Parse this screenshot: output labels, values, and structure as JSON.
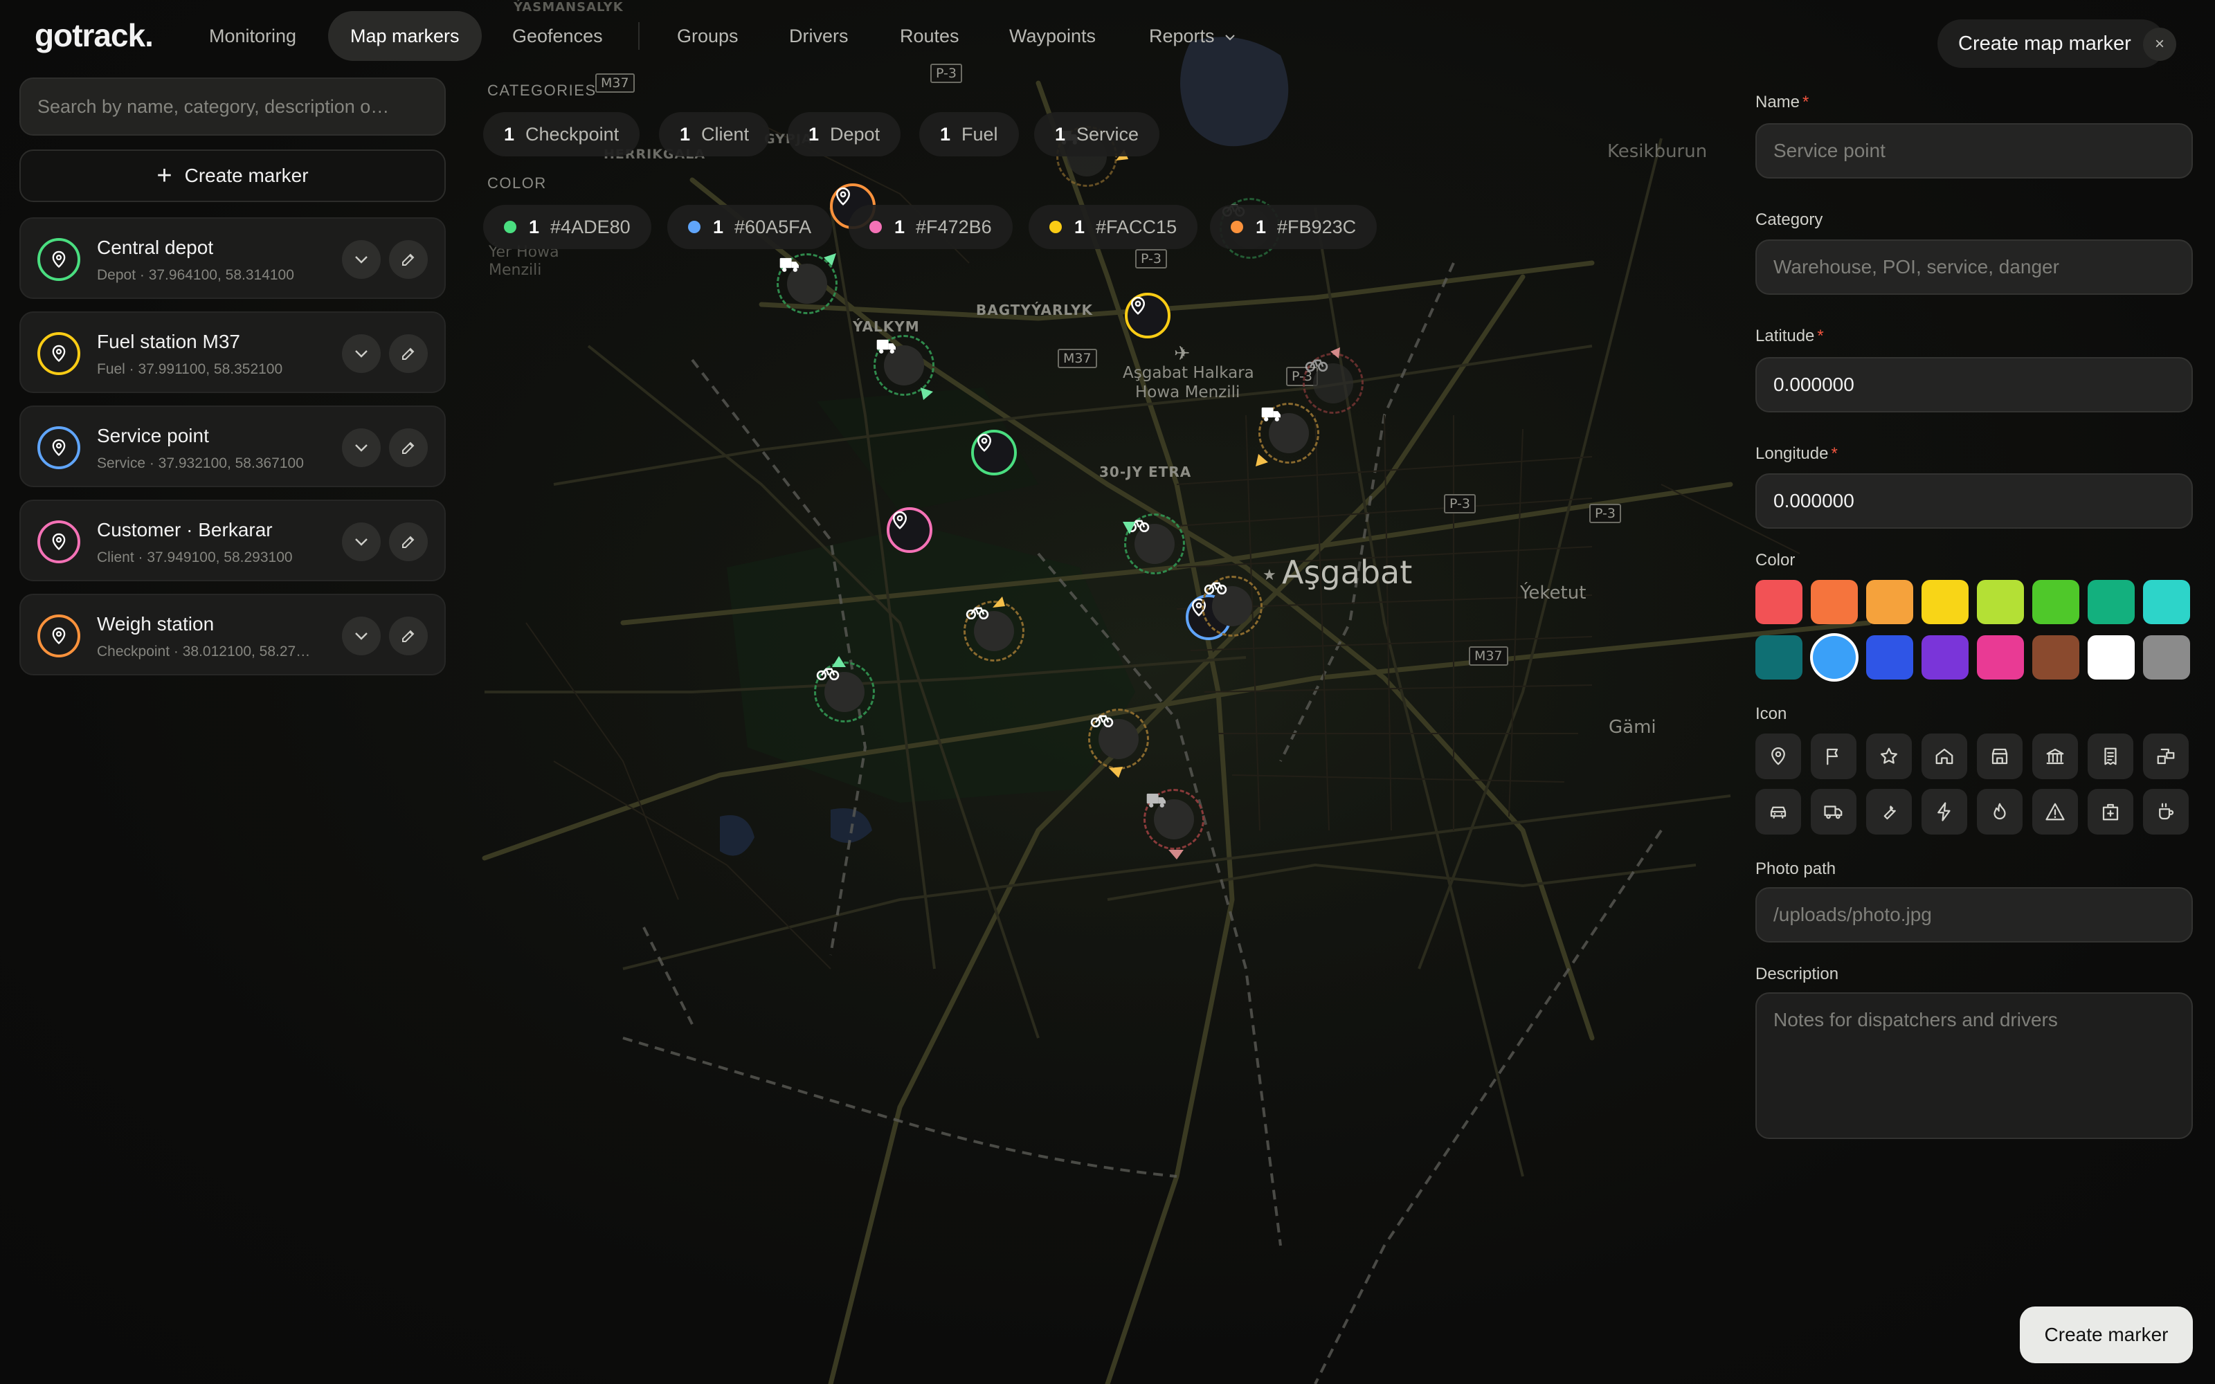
{
  "app": {
    "logo": "gotrack",
    "logo_dot": "."
  },
  "nav": {
    "items": [
      {
        "label": "Monitoring"
      },
      {
        "label": "Map markers"
      },
      {
        "label": "Geofences"
      },
      {
        "label": "Groups"
      },
      {
        "label": "Drivers"
      },
      {
        "label": "Routes"
      },
      {
        "label": "Waypoints"
      },
      {
        "label": "Reports"
      }
    ],
    "active": "Map markers"
  },
  "sidebar": {
    "search_placeholder": "Search by name, category, description o…",
    "create_label": "Create marker",
    "markers": [
      {
        "name": "Central depot",
        "meta": "Depot · 37.964100, 58.314100",
        "color": "#4ADE80"
      },
      {
        "name": "Fuel station M37",
        "meta": "Fuel · 37.991100, 58.352100",
        "color": "#FACC15"
      },
      {
        "name": "Service point",
        "meta": "Service · 37.932100, 58.367100",
        "color": "#60A5FA"
      },
      {
        "name": "Customer · Berkarar",
        "meta": "Client · 37.949100, 58.293100",
        "color": "#F472B6"
      },
      {
        "name": "Weigh station",
        "meta": "Checkpoint · 38.012100, 58.27…",
        "color": "#FB923C"
      }
    ]
  },
  "filters": {
    "categories_label": "CATEGORIES",
    "categories": [
      {
        "count": "1",
        "label": "Checkpoint"
      },
      {
        "count": "1",
        "label": "Client"
      },
      {
        "count": "1",
        "label": "Depot"
      },
      {
        "count": "1",
        "label": "Fuel"
      },
      {
        "count": "1",
        "label": "Service"
      }
    ],
    "color_label": "COLOR",
    "colors": [
      {
        "count": "1",
        "label": "#4ADE80",
        "color": "#4ADE80"
      },
      {
        "count": "1",
        "label": "#60A5FA",
        "color": "#60A5FA"
      },
      {
        "count": "1",
        "label": "#F472B6",
        "color": "#F472B6"
      },
      {
        "count": "1",
        "label": "#FACC15",
        "color": "#FACC15"
      },
      {
        "count": "1",
        "label": "#FB923C",
        "color": "#FB923C"
      }
    ]
  },
  "map": {
    "labels": {
      "city": "Aşgabat",
      "airport_1": "Aşgabat Halkara",
      "airport_2": "Howa Menzili",
      "district_1": "BAGTYÝARLYK",
      "district_2": "ÝALKYM",
      "district_3": "30-JY ETRA",
      "district_4": "HERRIKGALA",
      "district_5": "GYPJA",
      "district_6": "ÝASMANSALYK",
      "town_1": "Ýeketut",
      "town_2": "Gämi",
      "town_3": "Kesikburun",
      "airfield_1": "Ýer Howa",
      "airfield_2": "Menzili"
    },
    "road_badges": [
      "M37",
      "P-3",
      "P-3",
      "M37",
      "P-3",
      "P-3",
      "P-3",
      "M37"
    ]
  },
  "form": {
    "title": "Create map marker",
    "close": "×",
    "name_label": "Name",
    "name_placeholder": "Service point",
    "category_label": "Category",
    "category_placeholder": "Warehouse, POI, service, danger",
    "latitude_label": "Latitude",
    "latitude_value": "0.000000",
    "longitude_label": "Longitude",
    "longitude_value": "0.000000",
    "required_mark": "*",
    "color_label": "Color",
    "swatches": [
      "#F25255",
      "#F5743D",
      "#F5A23C",
      "#F8D517",
      "#B4E035",
      "#4FC82A",
      "#13B07E",
      "#2DD4C9",
      "#0F6F73",
      "#3AA0F8",
      "#2F55E6",
      "#7A35D9",
      "#E93A94",
      "#8A4A2E",
      "#FFFFFF",
      "#8B8B8B"
    ],
    "selected_swatch": 9,
    "icon_label": "Icon",
    "icons": [
      "pin-icon",
      "flag-icon",
      "star-icon",
      "home-icon",
      "store-icon",
      "bank-icon",
      "receipt-icon",
      "warehouse-icon",
      "car-icon",
      "truck-icon",
      "wrench-icon",
      "bolt-icon",
      "flame-icon",
      "warning-icon",
      "hospital-icon",
      "coffee-icon"
    ],
    "photo_label": "Photo path",
    "photo_placeholder": "/uploads/photo.jpg",
    "description_label": "Description",
    "description_placeholder": "Notes for dispatchers and drivers",
    "submit_label": "Create marker"
  }
}
